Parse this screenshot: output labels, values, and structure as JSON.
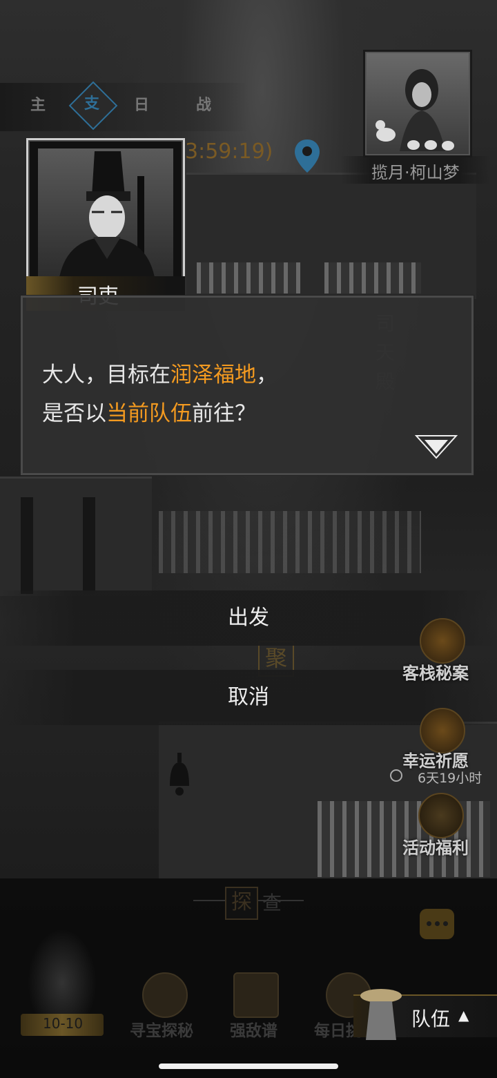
{
  "top_tabs": [
    "主",
    "支",
    "日",
    "战"
  ],
  "timer_text": "3:59:19)",
  "companion": {
    "name": "揽月·柯山梦"
  },
  "speaker": {
    "name": "司吏"
  },
  "dialogue": {
    "line1": {
      "pre": "大人，目标在",
      "highlight": "润泽福地",
      "post": "，"
    },
    "line2": {
      "pre": "是否以",
      "highlight": "当前队伍",
      "post": "前往？"
    }
  },
  "background_signs": {
    "temple_plaque": [
      "司",
      "天",
      "殿"
    ],
    "gather_sign": "聚"
  },
  "choices": [
    {
      "label": "出发"
    },
    {
      "label": "取消"
    }
  ],
  "side_activities": [
    {
      "label": "客栈秘案",
      "icon": "inn-icon"
    },
    {
      "label": "幸运祈愿",
      "icon": "wish-icon",
      "timer": "6天19小时"
    },
    {
      "label": "活动福利",
      "icon": "gift-icon"
    }
  ],
  "explore_header": {
    "char1": "探",
    "char2": "查"
  },
  "bottom_nav": {
    "level": "10-10",
    "items": [
      {
        "label": "寻宝探秘",
        "icon": "treasure-bag-icon"
      },
      {
        "label": "强敌谱",
        "icon": "scroll-icon"
      },
      {
        "label": "每日挑",
        "icon": "lantern-icon"
      }
    ],
    "team_label": "队伍",
    "team_arrow": "▲"
  },
  "colors": {
    "highlight": "#f39a20",
    "accent_gold": "#6a5626",
    "blue_pin": "#2e6f98"
  }
}
